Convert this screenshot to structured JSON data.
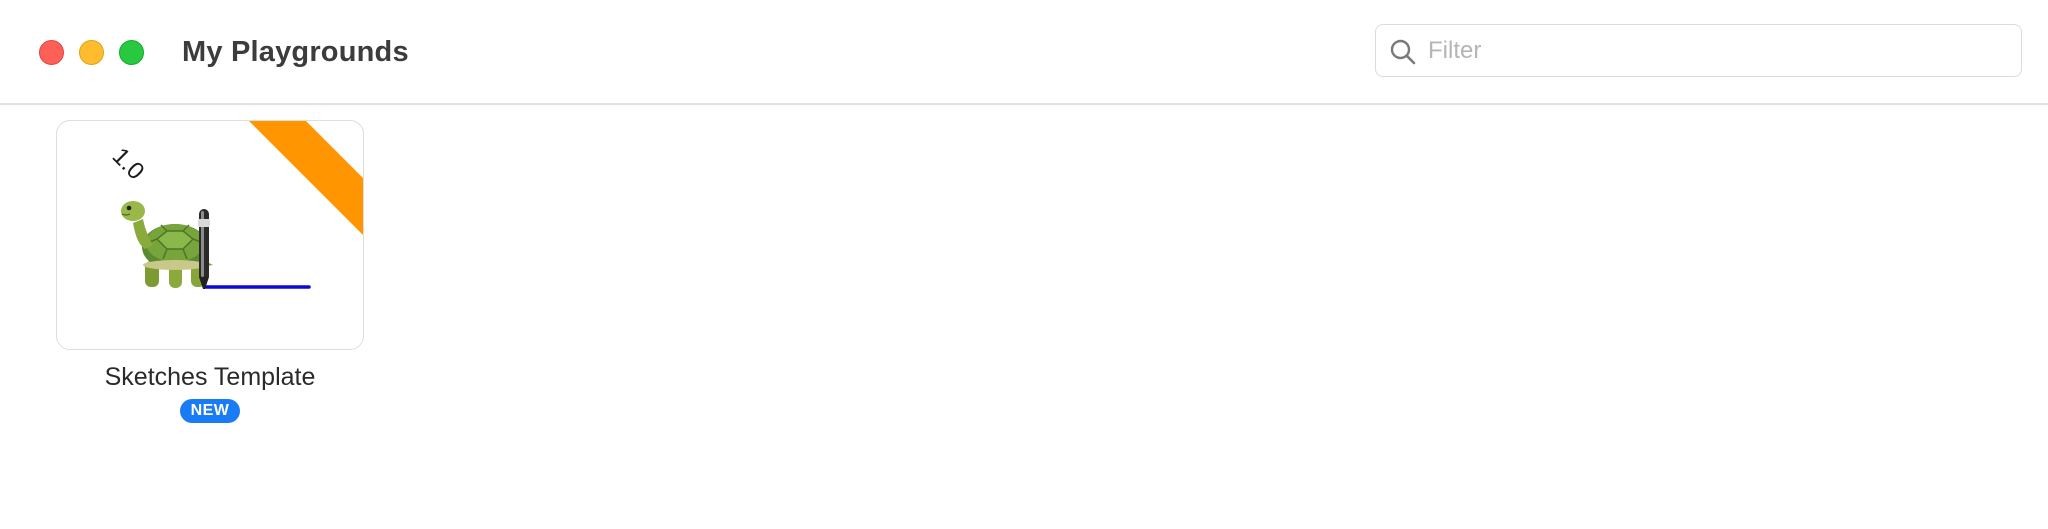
{
  "window": {
    "title": "My Playgrounds",
    "controls": {
      "close_color": "#fe5f57",
      "minimize_color": "#febc2e",
      "zoom_color": "#28c840"
    }
  },
  "search": {
    "placeholder": "Filter",
    "value": "",
    "icon": "magnifying-glass-icon"
  },
  "playgrounds": [
    {
      "title": "Sketches Template",
      "version": "1.0",
      "badge": "NEW",
      "thumbnail": "turtle-drawing-line",
      "ribbon_color": "#ff9500",
      "badge_color": "#1a7cf4",
      "line_color": "#0a0ad6"
    }
  ]
}
